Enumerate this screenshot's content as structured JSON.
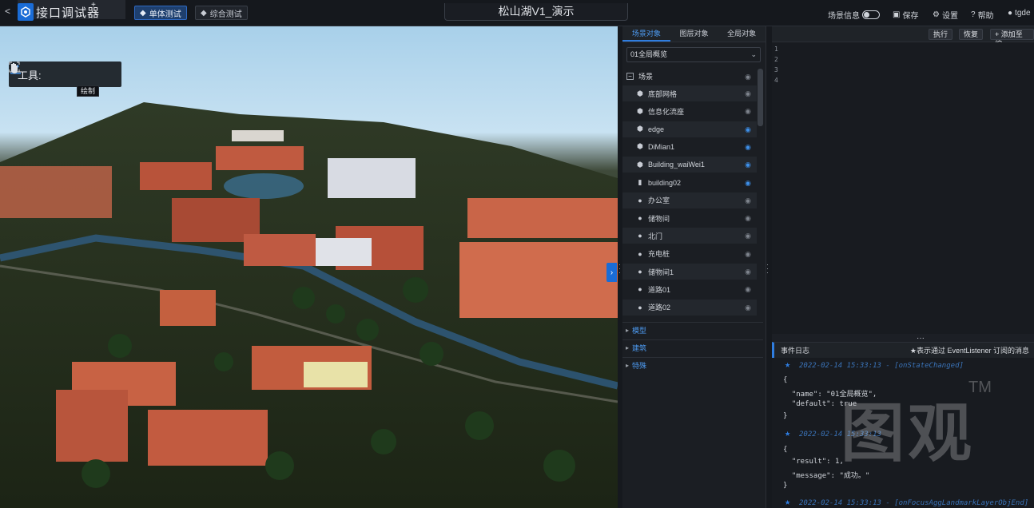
{
  "app": {
    "title": "接口调试器",
    "title_plus": "+",
    "back_label": "<",
    "modes": [
      {
        "label": "单体测试",
        "active": true
      },
      {
        "label": "综合测试",
        "active": false
      }
    ],
    "scene_title": "松山湖V1_演示"
  },
  "topbar_right": {
    "scene_info_label": "场景信息",
    "scene_info_on": false,
    "save_label": "保存",
    "settings_label": "设置",
    "help_label": "帮助",
    "user_label": "tgde"
  },
  "viewport": {
    "toolbar_label": "工具:",
    "tooltip": "绘制"
  },
  "scene_panel": {
    "tabs": [
      {
        "label": "场景对象",
        "active": true
      },
      {
        "label": "图层对象",
        "active": false
      },
      {
        "label": "全局对象",
        "active": false
      }
    ],
    "selected_scene": "01全局概览",
    "root_label": "场景",
    "items": [
      {
        "label": "底部网格",
        "icon": "cube-icon",
        "visible": false
      },
      {
        "label": "信息化流座",
        "icon": "cube-icon",
        "visible": false
      },
      {
        "label": "edge",
        "icon": "cube-icon",
        "visible": true
      },
      {
        "label": "DiMian1",
        "icon": "cube-icon",
        "visible": true
      },
      {
        "label": "Building_waiWei1",
        "icon": "cube-icon",
        "visible": true
      },
      {
        "label": "building02",
        "icon": "building-icon",
        "visible": true
      },
      {
        "label": "办公室",
        "icon": "pin-icon",
        "visible": false
      },
      {
        "label": "储物间",
        "icon": "pin-icon",
        "visible": false
      },
      {
        "label": "北门",
        "icon": "pin-icon",
        "visible": false
      },
      {
        "label": "充电桩",
        "icon": "pin-icon",
        "visible": false
      },
      {
        "label": "储物间1",
        "icon": "pin-icon",
        "visible": false
      },
      {
        "label": "道路01",
        "icon": "pin-icon",
        "visible": false
      },
      {
        "label": "道路02",
        "icon": "pin-icon",
        "visible": false
      }
    ],
    "groups": [
      "模型",
      "建筑",
      "特殊"
    ]
  },
  "code": {
    "run_label": "执行",
    "restore_label": "恢复",
    "add_label": "添加至综",
    "line_numbers": [
      "1",
      "2",
      "3",
      "4"
    ]
  },
  "log": {
    "title": "事件日志",
    "hint": "★表示通过 EventListener 订阅的消息",
    "entries": [
      {
        "time": "2022-02-14 15:33:13 - [onStateChanged]",
        "lines": [
          "{",
          "  \"name\": \"01全局概览\",",
          "  \"default\": true",
          "}"
        ]
      },
      {
        "time": "2022-02-14 15:33:13",
        "lines": [
          "{",
          "  \"result\": 1,",
          "  \"message\": \"成功。\"",
          "}"
        ]
      },
      {
        "time": "2022-02-14 15:33:13 - [onFocusAggLandmarkLayerObjEnd]",
        "lines": []
      }
    ]
  },
  "watermark": {
    "text": "图观",
    "tm": "TM"
  }
}
